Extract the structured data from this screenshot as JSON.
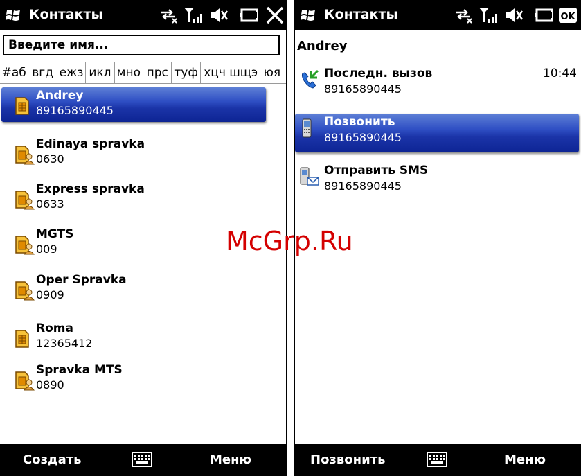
{
  "left": {
    "title": "Контакты",
    "search_placeholder": "Введите имя...",
    "alpha_index": [
      "#аб",
      "вгд",
      "ежз",
      "икл",
      "мно",
      "прс",
      "туф",
      "хцч",
      "шщэ",
      "юя"
    ],
    "contacts": [
      {
        "name": "Andrey",
        "number": "89165890445",
        "icon": "sim-card-icon",
        "selected": true
      },
      {
        "name": "Edinaya spravka",
        "number": "0630",
        "icon": "sim-contact-icon",
        "selected": false
      },
      {
        "name": "Express spravka",
        "number": "0633",
        "icon": "sim-contact-icon",
        "selected": false
      },
      {
        "name": "MGTS",
        "number": "009",
        "icon": "sim-contact-icon",
        "selected": false
      },
      {
        "name": "Oper Spravka",
        "number": "0909",
        "icon": "sim-contact-icon",
        "selected": false
      },
      {
        "name": "Roma",
        "number": "12365412",
        "icon": "sim-card-icon",
        "selected": false
      },
      {
        "name": "Spravka MTS",
        "number": "0890",
        "icon": "sim-contact-icon",
        "selected": false
      }
    ],
    "softkeys": {
      "left": "Создать",
      "right": "Меню"
    }
  },
  "right": {
    "title": "Контакты",
    "contact_name": "Andrey",
    "actions": [
      {
        "label": "Последн. вызов",
        "number": "89165890445",
        "time": "10:44",
        "icon": "phone-call-icon",
        "selected": false
      },
      {
        "label": "Позвонить",
        "number": "89165890445",
        "time": "",
        "icon": "mobile-phone-icon",
        "selected": true
      },
      {
        "label": "Отправить SMS",
        "number": "89165890445",
        "time": "",
        "icon": "sms-icon",
        "selected": false
      }
    ],
    "softkeys": {
      "left": "Позвонить",
      "right": "Меню"
    }
  },
  "watermark": "McGrp.Ru",
  "colors": {
    "titlebar": "#000000",
    "selection_top": "#5e80d6",
    "selection_bottom": "#0d2494",
    "watermark": "#d40000"
  }
}
